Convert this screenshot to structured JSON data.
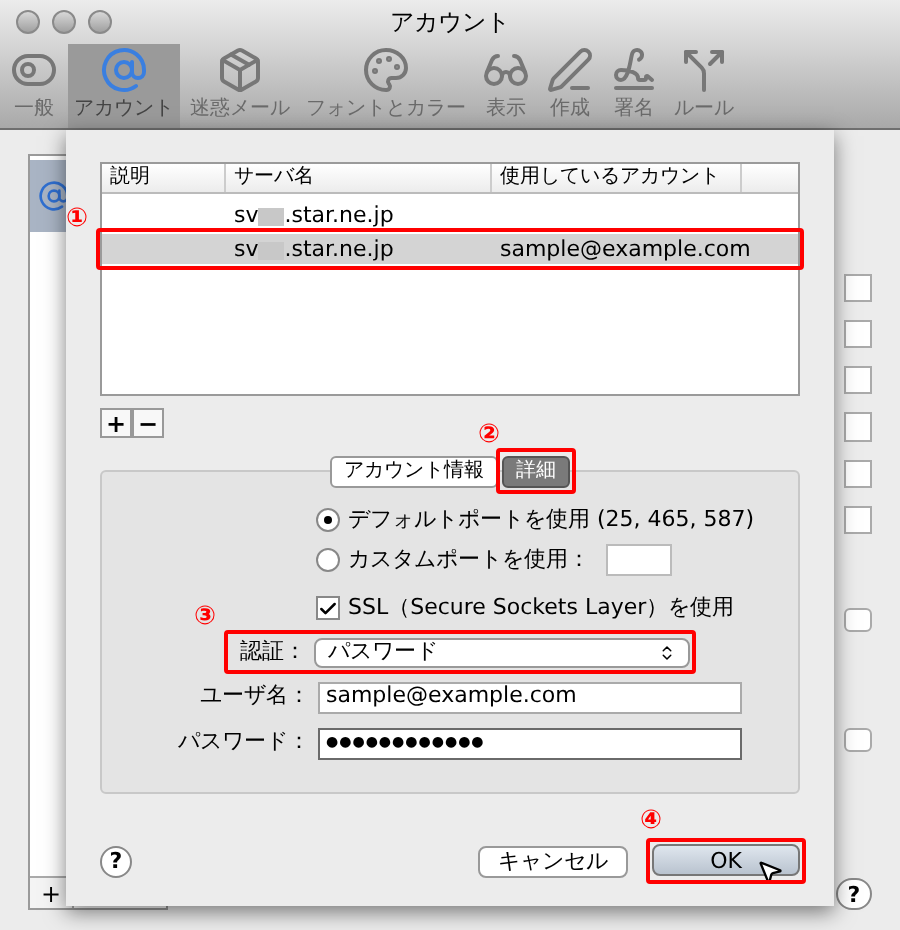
{
  "window": {
    "title": "アカウント"
  },
  "toolbar": [
    {
      "label": "一般",
      "selected": false
    },
    {
      "label": "アカウント",
      "selected": true
    },
    {
      "label": "迷惑メール",
      "selected": false
    },
    {
      "label": "フォントとカラー",
      "selected": false
    },
    {
      "label": "表示",
      "selected": false
    },
    {
      "label": "作成",
      "selected": false
    },
    {
      "label": "署名",
      "selected": false
    },
    {
      "label": "ルール",
      "selected": false
    }
  ],
  "background": {
    "add_button": "+",
    "help": "?"
  },
  "sheet": {
    "table": {
      "columns": [
        "説明",
        "サーバ名",
        "使用しているアカウント"
      ],
      "rows": [
        {
          "server_prefix": "sv",
          "server_suffix": ".star.ne.jp",
          "selected": false
        },
        {
          "server_prefix": "sv",
          "server_suffix": ".star.ne.jp",
          "account": "sample@example.com",
          "selected": true,
          "marker": "①"
        }
      ]
    },
    "list_buttons": [
      "+",
      "−"
    ],
    "tabs": [
      {
        "label": "アカウント情報",
        "selected": false
      },
      {
        "label": "詳細",
        "selected": true,
        "marker": "②"
      }
    ],
    "port_options": [
      {
        "label": "デフォルトポートを使用 (25, 465, 587)",
        "selected": true
      },
      {
        "label": "カスタムポートを使用：",
        "selected": false
      }
    ],
    "ssl": {
      "label": "SSL（Secure Sockets Layer）を使用",
      "checked": true
    },
    "auth": {
      "label": "認証：",
      "value": "パスワード",
      "marker": "③"
    },
    "username": {
      "label": "ユーザ名：",
      "value": "sample@example.com"
    },
    "password": {
      "label": "パスワード：",
      "value": "●●●●●●●●●●●●"
    },
    "help": "?",
    "cancel_button": "キャンセル",
    "ok_button": {
      "label": "OK",
      "marker": "④"
    }
  }
}
